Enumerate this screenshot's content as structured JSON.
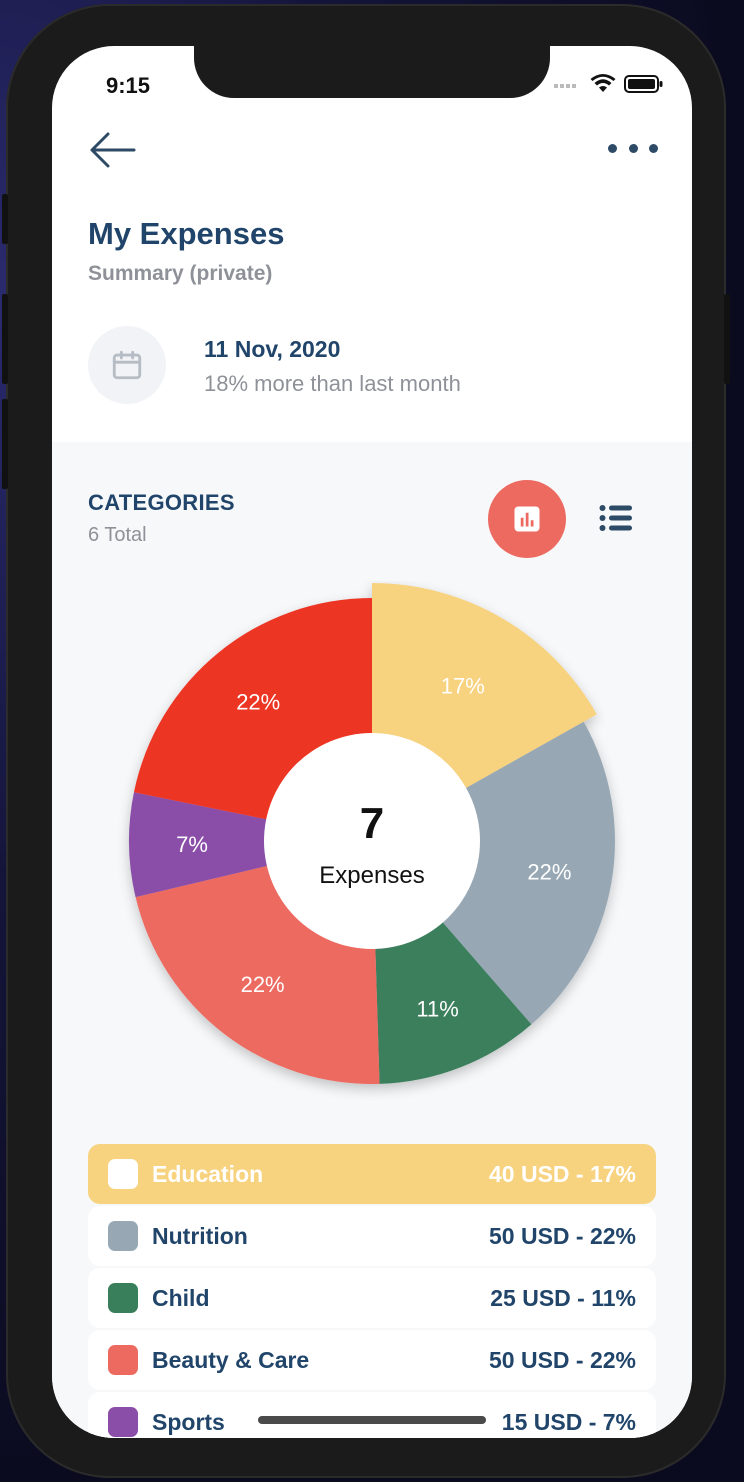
{
  "status": {
    "time": "9:15"
  },
  "header": {
    "title": "My Expenses",
    "subtitle": "Summary (private)"
  },
  "date_row": {
    "date": "11 Nov, 2020",
    "comparison": "18% more than last month"
  },
  "categories": {
    "title": "CATEGORIES",
    "count": "6 Total"
  },
  "donut": {
    "center_value": "7",
    "center_label": "Expenses"
  },
  "chart_data": {
    "type": "pie",
    "slices": [
      {
        "label": "Education",
        "value": 17,
        "text": "17%",
        "color": "#f7d27f",
        "explode": true
      },
      {
        "label": "Nutrition",
        "value": 22,
        "text": "22%",
        "color": "#97a8b4"
      },
      {
        "label": "Child",
        "value": 11,
        "text": "11%",
        "color": "#3a7f5c"
      },
      {
        "label": "Beauty & Care",
        "value": 22,
        "text": "22%",
        "color": "#ec6a60"
      },
      {
        "label": "Sports",
        "value": 7,
        "text": "7%",
        "color": "#8a4ea8"
      },
      {
        "label": "",
        "value": 22,
        "text": "22%",
        "color": "#ec3424"
      }
    ]
  },
  "legend": [
    {
      "name": "Education",
      "amount": "40 USD - 17%",
      "color": "#f7d27f",
      "swatch": "#ffffff",
      "active": true
    },
    {
      "name": "Nutrition",
      "amount": "50 USD - 22%",
      "color": "#97a8b4"
    },
    {
      "name": "Child",
      "amount": "25 USD - 11%",
      "color": "#3a7f5c"
    },
    {
      "name": "Beauty & Care",
      "amount": "50 USD - 22%",
      "color": "#ec6a60"
    },
    {
      "name": "Sports",
      "amount": "15 USD - 7%",
      "color": "#8a4ea8"
    }
  ],
  "icons": {
    "back": "arrow-left-icon",
    "more": "more-horizontal-icon",
    "calendar": "calendar-icon",
    "chart_view": "bar-chart-icon",
    "list_view": "list-icon"
  },
  "colors": {
    "accent": "#ec6a60",
    "title": "#21456a",
    "muted": "#8e9298"
  }
}
